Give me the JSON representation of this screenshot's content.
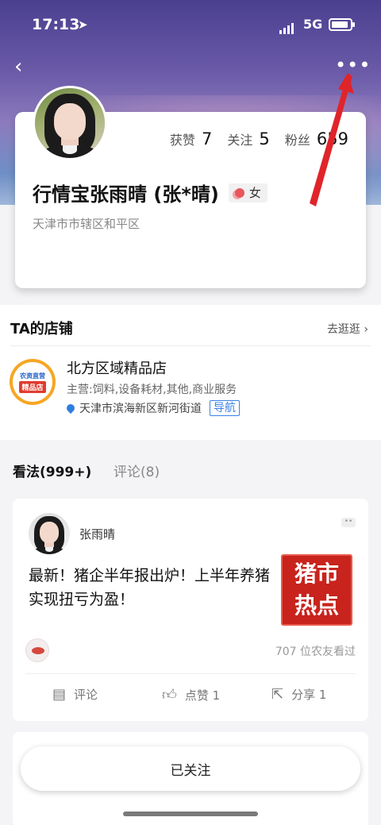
{
  "status_bar": {
    "time": "17:13",
    "location_glyph": "➤",
    "network": "5G"
  },
  "nav": {
    "back_glyph": "‹",
    "more_glyph": "•••"
  },
  "profile": {
    "stats": [
      {
        "label": "获赞",
        "value": "7"
      },
      {
        "label": "关注",
        "value": "5"
      },
      {
        "label": "粉丝",
        "value": "659"
      }
    ],
    "name": "行情宝张雨晴 (张*晴)",
    "gender": "女",
    "district": "天津市市辖区和平区"
  },
  "shop": {
    "section_title": "TA的店铺",
    "more_link": "去逛逛",
    "logo_line1": "农资直营",
    "logo_line2": "精品店",
    "name": "北方区域精品店",
    "business": "主营:饲料,设备耗材,其他,商业服务",
    "address": "天津市滨海新区新河街道",
    "nav_button": "导航"
  },
  "tabs": [
    {
      "label": "看法(999+)",
      "active": true
    },
    {
      "label": "评论(8)",
      "active": false
    }
  ],
  "post": {
    "author": "张雨晴",
    "text": "最新！猪企半年报出炉！上半年养猪实现扭亏为盈！",
    "thumb_line1": "猪市",
    "thumb_line2": "热点",
    "views": "707 位农友看过",
    "actions": {
      "comment": "评论",
      "like": "点赞 1",
      "share": "分享 1"
    }
  },
  "follow_button": "已关注",
  "colors": {
    "accent_blue": "#3a83e6",
    "thumb_red": "#c8231c",
    "annotation_red": "#e0242a"
  }
}
